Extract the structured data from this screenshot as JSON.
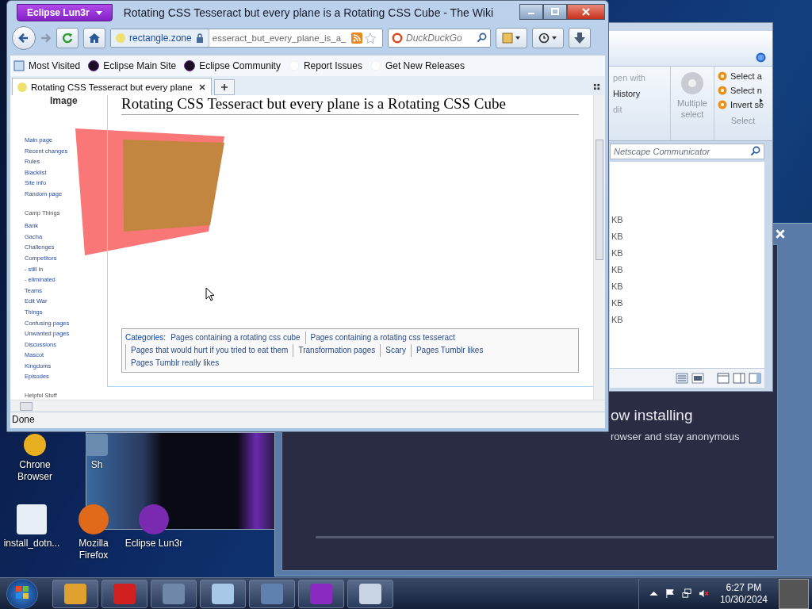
{
  "desktop_icons": [
    {
      "label": "Chrone Browser",
      "kind": "chrome"
    },
    {
      "label": "Sh",
      "kind": "shortcut"
    },
    {
      "label": "install_dotn...",
      "kind": "setup"
    },
    {
      "label": "Mozilla Firefox",
      "kind": "firefox"
    },
    {
      "label": "Eclipse Lun3r",
      "kind": "eclipse"
    }
  ],
  "installer": {
    "heading": "ow installing",
    "subtitle": "rowser and stay anonymous"
  },
  "explorer": {
    "commands": [
      {
        "label": "pen with",
        "disabled": true
      },
      {
        "label": "History",
        "disabled": false
      },
      {
        "label": "dit",
        "disabled": true
      }
    ],
    "multiple_select": "Multiple select",
    "select_items": [
      "Select a",
      "Select n",
      "Invert se"
    ],
    "group_label": "Select",
    "search": {
      "placeholder": "Netscape Communicator"
    },
    "sizes": [
      "KB",
      "KB",
      "KB",
      "KB",
      "KB",
      "KB",
      "KB"
    ]
  },
  "browser": {
    "app_button": "Eclipse Lun3r",
    "title": "Rotating CSS Tesseract but every plane is a Rotating CSS Cube - The Wiki",
    "url": {
      "host": "rectangle.zone",
      "path": "esseract_but_every_plane_is_a_"
    },
    "search": {
      "placeholder": "DuckDuckGo"
    },
    "bookmarks": [
      {
        "label": "Most Visited",
        "kind": "folder"
      },
      {
        "label": "Eclipse Main Site",
        "kind": "eclipse"
      },
      {
        "label": "Eclipse Community",
        "kind": "eclipse"
      },
      {
        "label": "Report Issues",
        "kind": "blank"
      },
      {
        "label": "Get New Releases",
        "kind": "blank"
      }
    ],
    "tabs": [
      {
        "label": "Rotating CSS Tesseract but every plane",
        "selected": true
      }
    ],
    "sidebar": {
      "logo": "Image",
      "nav": [
        "Main page",
        "Recent changes",
        "Rules",
        "Blacklist",
        "Site info",
        "Random page"
      ],
      "sections": [
        {
          "title": "Camp Things",
          "items": [
            "Bank",
            "Gacha",
            "Challenges",
            "Competitors",
            "- still in",
            "- eliminated",
            "Teams",
            "Edit War",
            "Things",
            "Confusing pages",
            "Unwanted pages",
            "Discussions",
            "Mascot",
            "Kingdoms",
            "Episodes"
          ]
        },
        {
          "title": "Helpful Stuff"
        }
      ]
    },
    "heading": "Rotating CSS Tesseract but every plane is a Rotating CSS Cube",
    "categories": {
      "label": "Categories:",
      "items": [
        "Pages containing a rotating css cube",
        "Pages containing a rotating css tesseract",
        "Pages that would hurt if you tried to eat them",
        "Transformation pages",
        "Scary",
        "Pages Tumblr likes",
        "Pages Tumblr really likes"
      ]
    },
    "status": "Done"
  },
  "taskbar": {
    "time": "6:27 PM",
    "date": "10/30/2024"
  }
}
